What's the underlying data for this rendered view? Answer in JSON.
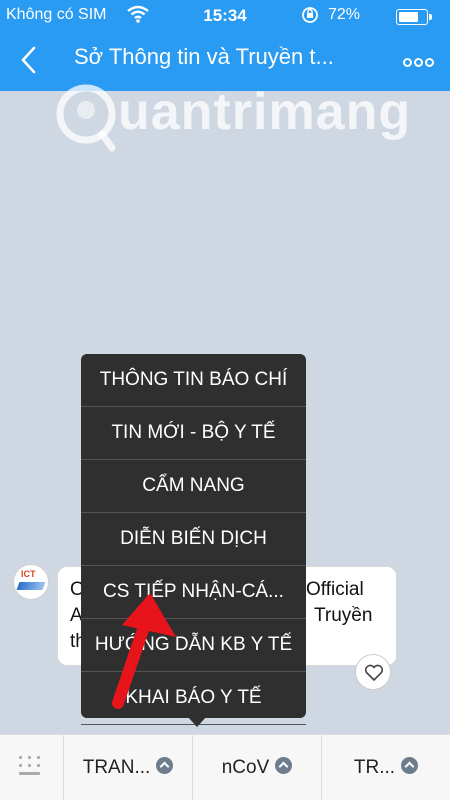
{
  "status_bar": {
    "carrier": "Không có SIM",
    "time": "15:34",
    "battery_percent": "72%",
    "battery_level": 0.72
  },
  "nav": {
    "title": "Sở Thông tin và Truyền t...",
    "back_icon": "chevron-left-icon",
    "more_icon": "more-dots-icon"
  },
  "watermark": {
    "text": "uantrimang"
  },
  "chat": {
    "avatar_text": "ICT",
    "bubble_line1_left": "O",
    "bubble_line2_left": "A",
    "bubble_line3_left": "th",
    "bubble_line1_right": "Official",
    "bubble_line2_right": "Truyền"
  },
  "popup_menu": {
    "items": [
      "THÔNG TIN BÁO CHÍ",
      "TIN MỚI - BỘ Y TẾ",
      "CẨM NANG",
      "DIỄN BIẾN DỊCH",
      "CS TIẾP NHẬN-CÁ...",
      "HƯỚNG DẪN KB Y TẾ",
      "KHAI BÁO Y TẾ"
    ]
  },
  "bottom_bar": {
    "menus": [
      "TRAN...",
      "nCoV",
      "TR..."
    ]
  },
  "colors": {
    "header": "#2a9bf3",
    "popup": "#2f2f30",
    "annotation_arrow": "#e8141b",
    "background": "#cfd8e2"
  }
}
